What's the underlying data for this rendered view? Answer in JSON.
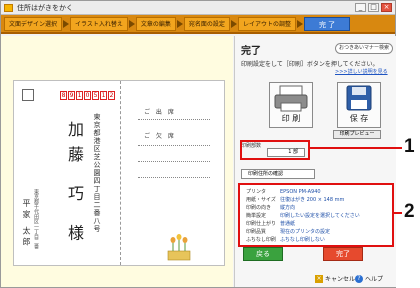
{
  "window": {
    "title": "住所はがきをかく",
    "min_label": "_",
    "max_label": "□",
    "close_label": "×"
  },
  "steps": [
    {
      "label": "文面デザイン選択"
    },
    {
      "label": "イラスト入れ替え"
    },
    {
      "label": "文章の編集"
    },
    {
      "label": "宛名面の設定"
    },
    {
      "label": "レイアウトの調整"
    },
    {
      "label": "完 了"
    }
  ],
  "preview": {
    "zip_digits": [
      "8",
      "9",
      "1",
      "0",
      "5",
      "1",
      "2"
    ],
    "recipient_name": "加藤 巧 様",
    "recipient_address": "東京都港区芝公園四丁目二番八号",
    "sender_name": "平家 太郎",
    "sender_address": "東京都千代田区一丁目二番",
    "reply_title": "ご 出 席",
    "reply_sub": "ご 欠 席"
  },
  "panel": {
    "heading": "完了",
    "help_button": "おつきあいマナー検索",
    "instruction": "印刷設定をして［印刷］ボタンを押してください。",
    "detail_link": ">>>詳しい説明を見る",
    "print_button": "印 刷",
    "save_button": "保 存",
    "print_preview_button": "印刷プレビュー",
    "copies_label": "印刷部数",
    "copies_value": "1 部",
    "address_list_button": "印刷住所の確認",
    "settings": [
      {
        "key": "プリンタ",
        "value": "EPSON PM-A940"
      },
      {
        "key": "用紙・サイズ",
        "value": "往復はがき 200 × 148 mm"
      },
      {
        "key": "印刷の向き",
        "value": "縦方向"
      },
      {
        "key": "簡単設定",
        "value": "印刷したい設定を選択してください"
      },
      {
        "key": "印刷仕上がり",
        "value": "普通紙"
      },
      {
        "key": "印刷品質",
        "value": "現在のプリンタの設定"
      },
      {
        "key": "ふちなし印刷",
        "value": "ふちなし印刷しない"
      }
    ],
    "back_button": "戻る",
    "finish_button": "完了",
    "cancel_link": "キャンセル",
    "help_link": "ヘルプ"
  },
  "callouts": {
    "one": "1",
    "two": "2"
  },
  "colors": {
    "steps_bar": "#d88810",
    "active_step": "#3d7bd5",
    "highlight": "#e01010",
    "back_button": "#3aa23e",
    "finish_button": "#e64a2e"
  }
}
